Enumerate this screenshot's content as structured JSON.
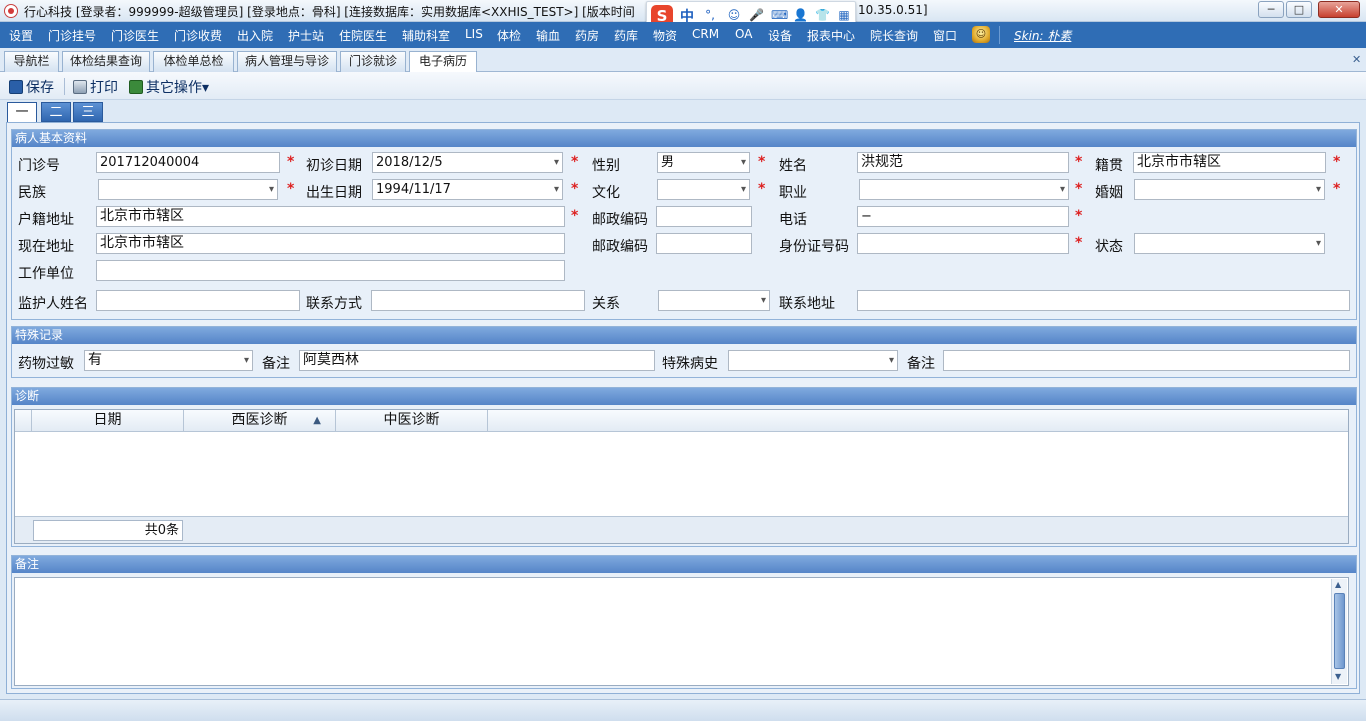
{
  "titlebar": {
    "title": "行心科技 [登录者：999999-超级管理员] [登录地点：骨科] [连接数据库：实用数据库<XXHIS_TEST>] [版本时间",
    "version": "10.35.0.51]",
    "min": "─",
    "max": "□",
    "close": "✕"
  },
  "ime": {
    "logo": "S",
    "mode": "中",
    "punct": "°,",
    "icons": [
      "☺",
      "🎤",
      "⌨",
      "👤",
      "👕",
      "▦"
    ]
  },
  "menu": {
    "items": [
      "设置",
      "门诊挂号",
      "门诊医生",
      "门诊收费",
      "出入院",
      "护士站",
      "住院医生",
      "辅助科室",
      "LIS",
      "体检",
      "输血",
      "药房",
      "药库",
      "物资",
      "CRM",
      "OA",
      "设备",
      "报表中心",
      "院长查询",
      "窗口"
    ],
    "skin": "Skin: 朴素",
    "hat": "☺"
  },
  "tabs": {
    "items": [
      "导航栏",
      "体检结果查询",
      "体检单总检",
      "病人管理与导诊",
      "门诊就诊",
      "电子病历"
    ],
    "close": "✕"
  },
  "toolbar": {
    "save": "保存",
    "print": "打印",
    "other": "其它操作▾"
  },
  "subtabs": [
    "一",
    "二",
    "三"
  ],
  "basic": {
    "header": "病人基本资料",
    "labels": {
      "outpatient_no": "门诊号",
      "first_date": "初诊日期",
      "gender": "性别",
      "name": "姓名",
      "origin": "籍贯",
      "ethnicity": "民族",
      "birth_date": "出生日期",
      "education": "文化",
      "occupation": "职业",
      "marital": "婚姻",
      "reg_addr": "户籍地址",
      "zip1": "邮政编码",
      "phone": "电话",
      "cur_addr": "现在地址",
      "zip2": "邮政编码",
      "id_no": "身份证号码",
      "status": "状态",
      "work_unit": "工作单位",
      "guardian": "监护人姓名",
      "contact": "联系方式",
      "relation": "关系",
      "contact_addr": "联系地址"
    },
    "values": {
      "outpatient_no": "201712040004",
      "first_date": "2018/12/5",
      "gender": "男",
      "name": "洪规范",
      "origin": "北京市市辖区",
      "ethnicity": "",
      "birth_date": "1994/11/17",
      "education": "",
      "occupation": "",
      "marital": "",
      "reg_addr": "北京市市辖区",
      "zip1": "",
      "phone": "−",
      "cur_addr": "北京市市辖区",
      "zip2": "",
      "id_no": "",
      "status": "",
      "work_unit": "",
      "guardian": "",
      "contact": "",
      "relation": "",
      "contact_addr": ""
    },
    "required": "*"
  },
  "special": {
    "header": "特殊记录",
    "labels": {
      "allergy": "药物过敏",
      "note1": "备注",
      "history": "特殊病史",
      "note2": "备注"
    },
    "values": {
      "allergy": "有",
      "note1": "阿莫西林",
      "history": "",
      "note2": ""
    }
  },
  "diagnosis": {
    "header": "诊断",
    "columns": [
      "日期",
      "西医诊断",
      "中医诊断"
    ],
    "sort_arrow": "▲",
    "count": "共0条"
  },
  "remarks": {
    "header": "备注",
    "up": "▲",
    "down": "▼"
  },
  "colors": {
    "menubar": "#2f6db5",
    "group_head": "#5585c8",
    "required": "#dd2222"
  }
}
